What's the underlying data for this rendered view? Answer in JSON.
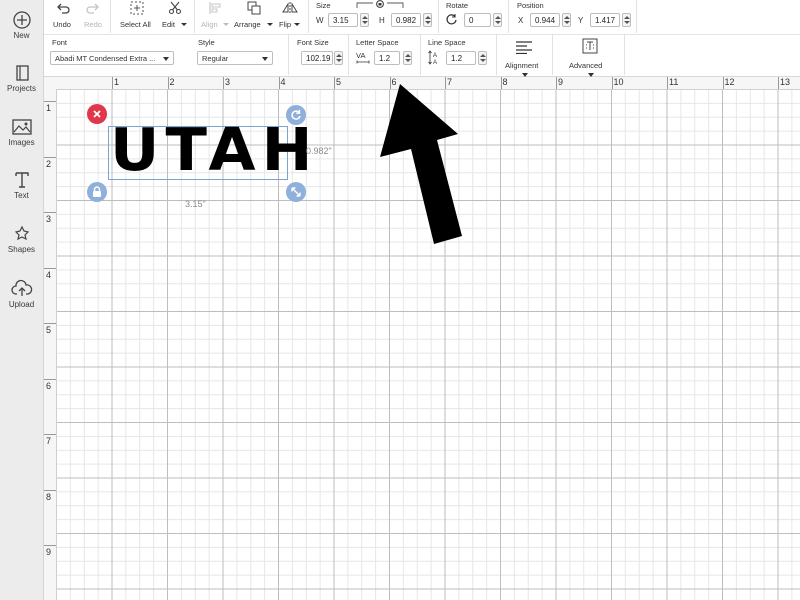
{
  "sidebar": {
    "items": [
      {
        "label": "New",
        "icon": "plus-circle-icon"
      },
      {
        "label": "Projects",
        "icon": "book-icon"
      },
      {
        "label": "Images",
        "icon": "image-icon"
      },
      {
        "label": "Text",
        "icon": "text-icon"
      },
      {
        "label": "Shapes",
        "icon": "shapes-icon"
      },
      {
        "label": "Upload",
        "icon": "cloud-upload-icon"
      }
    ]
  },
  "toolbar": {
    "undo": "Undo",
    "redo": "Redo",
    "select_all": "Select All",
    "edit": "Edit",
    "align": "Align",
    "arrange": "Arrange",
    "flip": "Flip",
    "size": {
      "title": "Size",
      "w_label": "W",
      "w_value": "3.15",
      "h_label": "H",
      "h_value": "0.982"
    },
    "rotate": {
      "title": "Rotate",
      "value": "0"
    },
    "position": {
      "title": "Position",
      "x_label": "X",
      "x_value": "0.944",
      "y_label": "Y",
      "y_value": "1.417"
    }
  },
  "text_toolbar": {
    "font": {
      "title": "Font",
      "value": "Abadi MT Condensed Extra ..."
    },
    "style": {
      "title": "Style",
      "value": "Regular"
    },
    "font_size": {
      "title": "Font Size",
      "value": "102.19"
    },
    "letter_space": {
      "title": "Letter Space",
      "value": "1.2"
    },
    "line_space": {
      "title": "Line Space",
      "value": "1.2"
    },
    "alignment": "Alignment",
    "advanced": "Advanced"
  },
  "rulers": {
    "top": [
      "1",
      "2",
      "3",
      "4",
      "5",
      "6",
      "7",
      "8",
      "9",
      "10",
      "11",
      "12",
      "13"
    ],
    "left": [
      "1",
      "2",
      "3",
      "4",
      "5",
      "6",
      "7",
      "8",
      "9"
    ]
  },
  "canvas": {
    "text_object": "UTAH",
    "width_readout": "3.15\"",
    "height_readout": "0.982\""
  },
  "colors": {
    "delete_handle": "#e0374b",
    "handle_blue": "#8fb0da",
    "arrow": "#000000"
  }
}
